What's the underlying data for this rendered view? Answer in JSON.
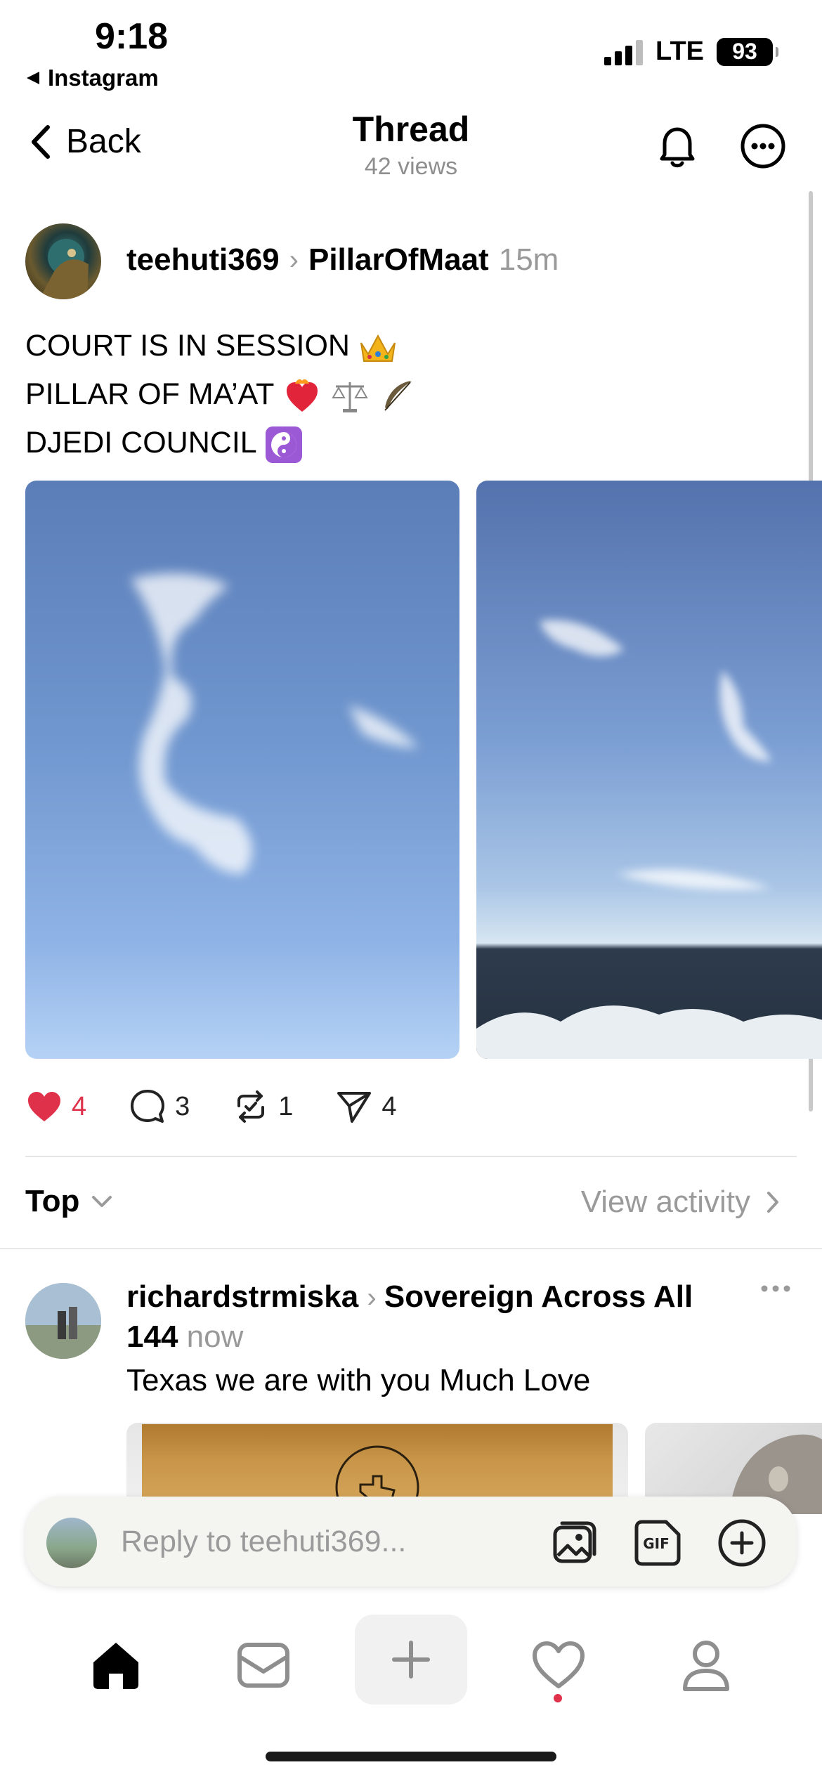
{
  "status_bar": {
    "time": "9:18",
    "back_app": "Instagram",
    "network": "LTE",
    "battery": "93"
  },
  "header": {
    "back_label": "Back",
    "title": "Thread",
    "views": "42 views"
  },
  "post": {
    "username": "teehuti369",
    "community": "PillarOfMaat",
    "time": "15m",
    "lines": [
      "COURT IS IN SESSION",
      "PILLAR OF MA’AT",
      "DJEDI COUNCIL"
    ],
    "likes": "4",
    "comments": "3",
    "reposts": "1",
    "shares": "4",
    "liked": true,
    "accent": "#e0314b"
  },
  "sort": {
    "label": "Top",
    "view_activity": "View activity"
  },
  "reply": {
    "username": "richardstrmiska",
    "community": "Sovereign Across All 144",
    "time": "now",
    "text": "Texas we are with you Much Love"
  },
  "composer": {
    "placeholder": "Reply to teehuti369..."
  },
  "tabbar": {
    "items": [
      "home-icon",
      "inbox-icon",
      "create-icon",
      "activity-icon",
      "profile-icon"
    ]
  }
}
